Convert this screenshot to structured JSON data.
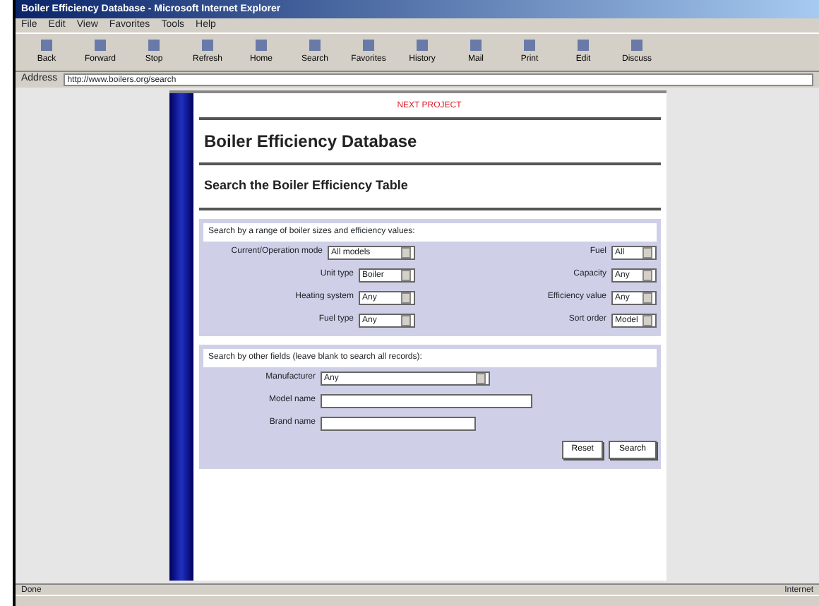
{
  "window": {
    "title": "Boiler Efficiency Database - Microsoft Internet Explorer"
  },
  "menu": [
    "File",
    "Edit",
    "View",
    "Favorites",
    "Tools",
    "Help"
  ],
  "toolbar": [
    "Back",
    "Forward",
    "Stop",
    "Refresh",
    "Home",
    "Search",
    "Favorites",
    "History",
    "Mail",
    "Print",
    "Edit",
    "Discuss"
  ],
  "address": {
    "label": "Address",
    "value": "http://www.boilers.org/search"
  },
  "page": {
    "banner": "NEXT PROJECT",
    "heading": "Boiler Efficiency Database",
    "subheading": "Search the Boiler Efficiency Table",
    "range_section": {
      "title": "Search by a range of boiler sizes and efficiency values:",
      "rows": [
        {
          "left_label": "Current/Operation mode",
          "left_value": "All models",
          "right_label": "Fuel",
          "right_value": "All"
        },
        {
          "left_label": "Unit type",
          "left_value": "Boiler",
          "right_label": "Capacity",
          "right_value": "Any"
        },
        {
          "left_label": "Heating system",
          "left_value": "Any",
          "right_label": "Efficiency value",
          "right_value": "Any"
        },
        {
          "left_label": "Fuel type",
          "left_value": "Any",
          "right_label": "Sort order",
          "right_value": "Model"
        }
      ]
    },
    "field_section": {
      "title": "Search by other fields (leave blank to search all records):",
      "fields": [
        {
          "kind": "select",
          "label": "Manufacturer",
          "value": "Any"
        },
        {
          "kind": "text",
          "label": "Model name"
        },
        {
          "kind": "text",
          "label": "Brand name"
        }
      ],
      "buttons": [
        "Reset",
        "Search"
      ]
    }
  },
  "status_bar": {
    "left": "Done",
    "right": "Internet"
  }
}
